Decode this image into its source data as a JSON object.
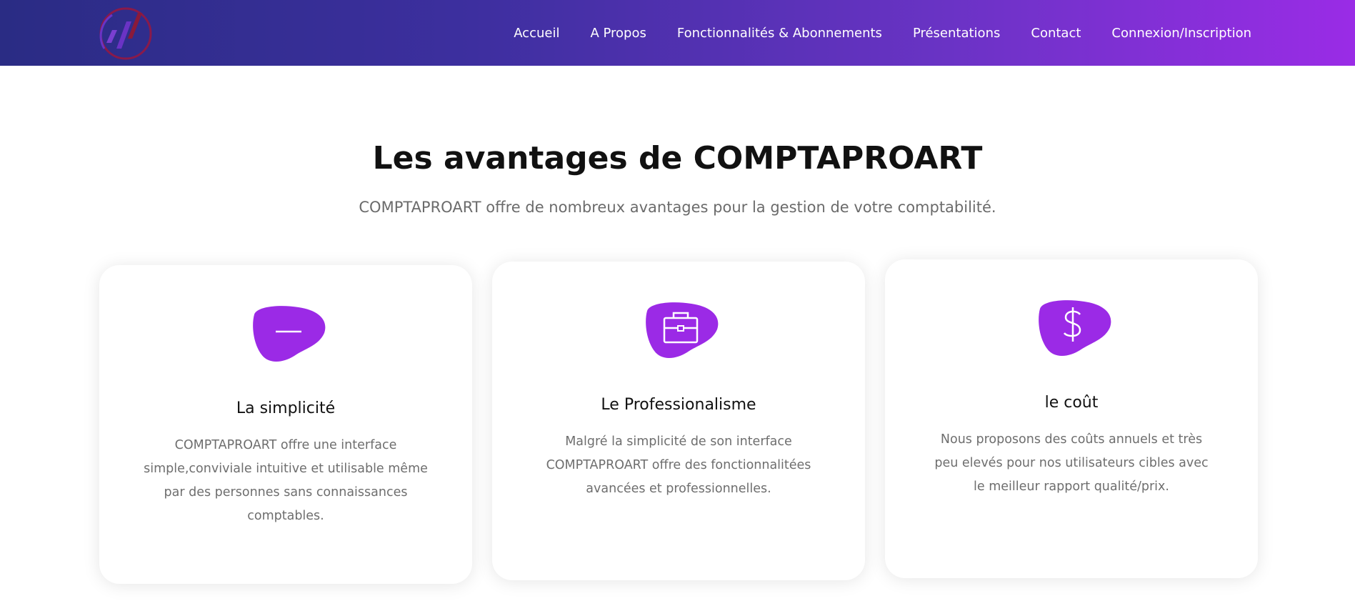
{
  "nav": {
    "links": [
      "Accueil",
      "A Propos",
      "Fonctionnalités & Abonnements",
      "Présentations",
      "Contact",
      "Connexion/Inscription"
    ]
  },
  "logo": {
    "icon": "chart-logo-icon",
    "colors": [
      "#6a33c5",
      "#8a1a3a"
    ]
  },
  "section": {
    "title": "Les avantages de COMPTAPROART",
    "subtitle": "COMPTAPROART offre de nombreux avantages pour la gestion de votre comptabilité."
  },
  "cards": [
    {
      "icon": "dash-icon",
      "title": "La simplicité",
      "description": "COMPTAPROART offre une interface simple,conviviale intuitive et utilisable même par des personnes sans connaissances comptables."
    },
    {
      "icon": "briefcase-icon",
      "title": "Le Professionalisme",
      "description": "Malgré la simplicité de son interface COMPTAPROART offre des fonctionnalitées avancées et professionnelles."
    },
    {
      "icon": "dollar-icon",
      "title": "le coût",
      "description": "Nous proposons des coûts annuels et très peu elevés pour nos utilisateurs cibles avec le meilleur rapport qualité/prix."
    }
  ],
  "colors": {
    "accent": "#9b2ae6",
    "navbar_start": "#2a2c84",
    "navbar_end": "#9a2ce6"
  }
}
